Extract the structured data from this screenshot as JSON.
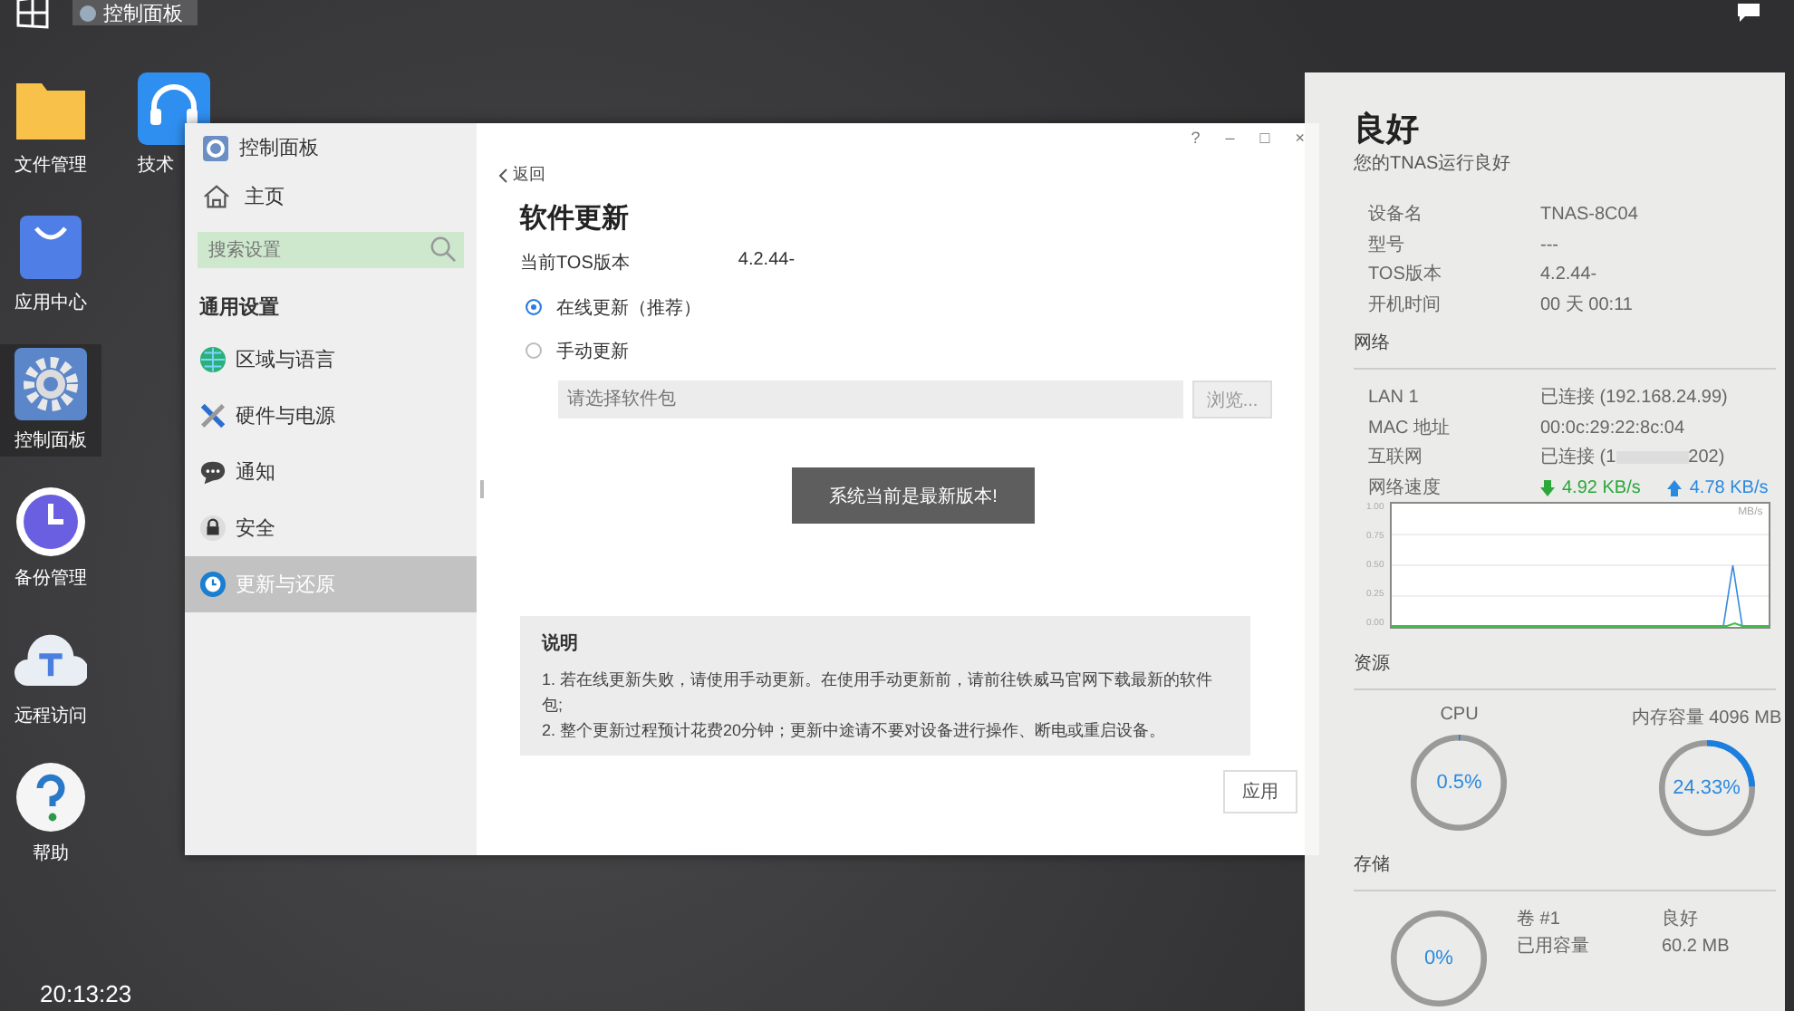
{
  "taskbar": {
    "tasks": [
      {
        "label": "控制面板",
        "selected": true
      }
    ]
  },
  "desktop_icons": [
    {
      "kind": "folder",
      "label": "文件管理"
    },
    {
      "kind": "support",
      "label": "技术"
    },
    {
      "kind": "store",
      "label": "应用中心"
    },
    {
      "kind": "settings",
      "label": "控制面板",
      "selected": true
    },
    {
      "kind": "backup",
      "label": "备份管理"
    },
    {
      "kind": "remote",
      "label": "远程访问"
    },
    {
      "kind": "help",
      "label": "帮助"
    }
  ],
  "clock": "20:13:23",
  "window": {
    "title": "控制面板",
    "title_buttons": [
      "?",
      "–",
      "□",
      "×"
    ],
    "sidebar": {
      "home": "主页",
      "search": {
        "placeholder": "搜索设置"
      },
      "section": "通用设置",
      "items": [
        {
          "kind": "globe",
          "label": "区域与语言",
          "selected": false
        },
        {
          "kind": "tools",
          "label": "硬件与电源",
          "selected": false
        },
        {
          "kind": "chat",
          "label": "通知",
          "selected": false
        },
        {
          "kind": "lock",
          "label": "安全",
          "selected": false
        },
        {
          "kind": "update",
          "label": "更新与还原",
          "selected": true
        }
      ]
    },
    "content": {
      "back": "返回",
      "heading": "软件更新",
      "version_label": "当前TOS版本",
      "version_value": "4.2.44-",
      "options": [
        {
          "label": "在线更新（推荐）",
          "selected": true
        },
        {
          "label": "手动更新",
          "selected": false
        }
      ],
      "package_field": {
        "placeholder": "请选择软件包",
        "disabled": true
      },
      "browse": "浏览...",
      "status_button": "系统当前是最新版本!",
      "notes": {
        "title": "说明",
        "lines": [
          "1. 若在线更新失败，请使用手动更新。在使用手动更新前，请前往铁威马官网下载最新的软件包;",
          "2. 整个更新过程预计花费20分钟；更新中途请不要对设备进行操作、断电或重启设备。"
        ]
      },
      "apply": "应用"
    }
  },
  "status_panel": {
    "title": "良好",
    "subtitle": "您的TNAS运行良好",
    "device": [
      {
        "label": "设备名",
        "value": "TNAS-8C04"
      },
      {
        "label": "型号",
        "value": "---"
      },
      {
        "label": "TOS版本",
        "value": "4.2.44-"
      },
      {
        "label": "开机时间",
        "value": "00 天 00:11"
      }
    ],
    "network_title": "网络",
    "network": [
      {
        "label": "LAN 1",
        "value": "已连接 (192.168.24.99)"
      },
      {
        "label": "MAC 地址",
        "value": "00:0c:29:22:8c:04"
      },
      {
        "label": "互联网",
        "value": "已连接 (1",
        "value_end": "202)"
      }
    ],
    "speed_label": "网络速度",
    "download": "4.92 KB/s",
    "upload": "4.78 KB/s",
    "graph": {
      "unit": "MB/s",
      "tick_labels": [
        "1.00",
        "0.75",
        "0.50",
        "0.25",
        "0.00"
      ]
    },
    "resources_title": "资源",
    "rings": [
      {
        "label": "CPU",
        "reading": "0.5%",
        "level": 0.005
      },
      {
        "label": "内存容量 4096 MB",
        "reading": "24.33%",
        "level": 0.2433
      }
    ],
    "storage_title": "存储",
    "storage_ring": {
      "reading": "0%",
      "level": 0
    },
    "storage": [
      {
        "label": "卷 #1",
        "value": "良好"
      },
      {
        "label": "已用容量",
        "value": "60.2 MB"
      }
    ]
  }
}
